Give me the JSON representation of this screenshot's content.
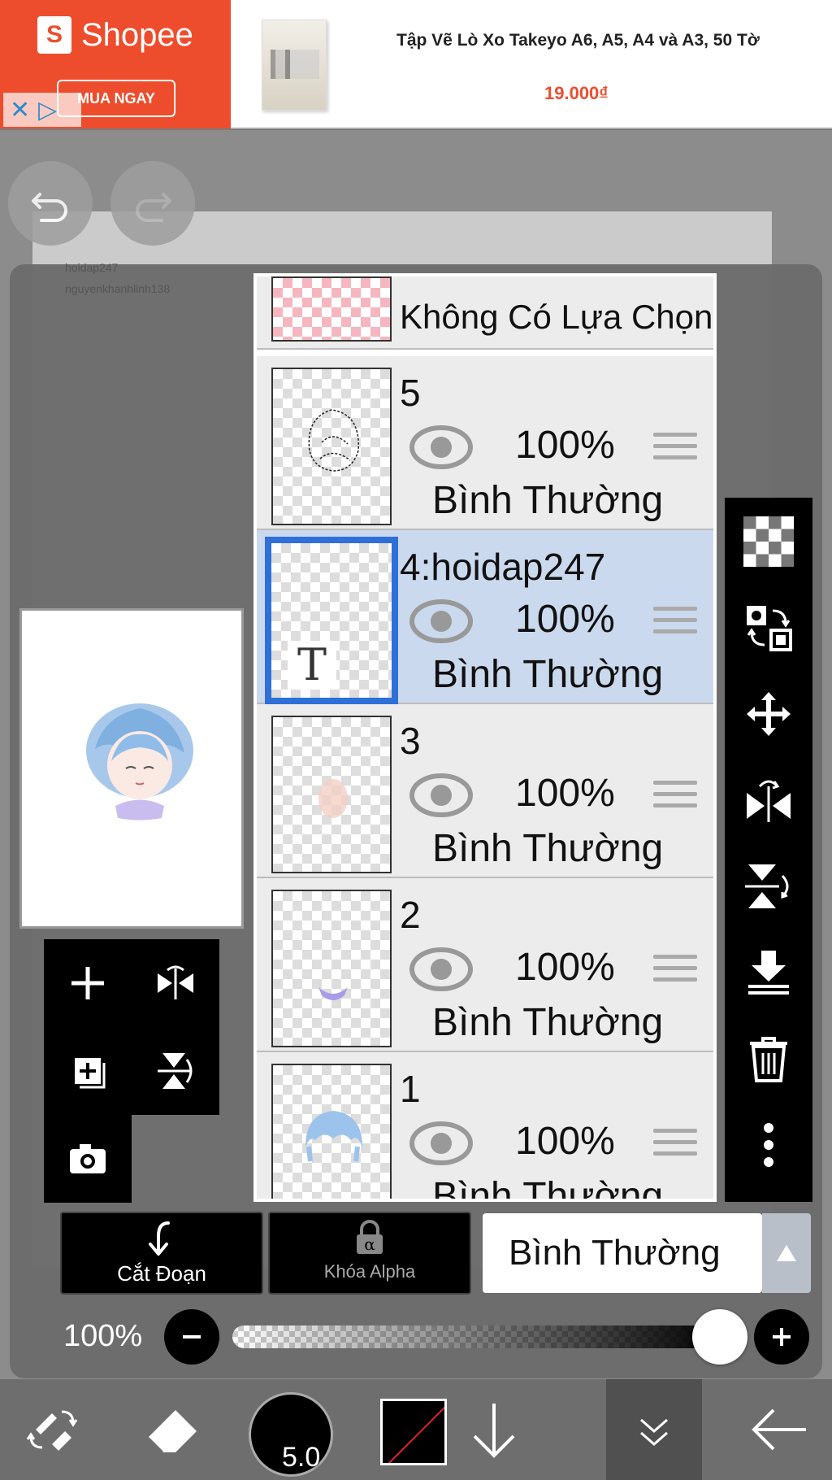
{
  "ad": {
    "brand": "Shopee",
    "cta": "MUA NGAY",
    "product_title": "Tập Vẽ Lò Xo Takeyo A6, A5, A4 và A3, 50 Tờ",
    "price": "19.000₫",
    "brand_color": "#ee4d2d"
  },
  "canvas": {
    "watermark_1": "hoidap247",
    "watermark_2": "nguyenkhanhlinh138"
  },
  "layers": {
    "selection_row": {
      "label": "Không Có Lựa Chọn"
    },
    "items": [
      {
        "name": "5",
        "opacity": "100%",
        "blend": "Bình Thường",
        "selected": false
      },
      {
        "name": "4:hoidap247",
        "opacity": "100%",
        "blend": "Bình Thường",
        "selected": true,
        "type": "T"
      },
      {
        "name": "3",
        "opacity": "100%",
        "blend": "Bình Thường",
        "selected": false
      },
      {
        "name": "2",
        "opacity": "100%",
        "blend": "Bình Thường",
        "selected": false
      },
      {
        "name": "1",
        "opacity": "100%",
        "blend": "Bình Thường",
        "selected": false
      }
    ],
    "selected_color": "#cbd9ee",
    "selected_border": "#2f6fd8"
  },
  "buttons": {
    "clipping": "Cắt Đoạn",
    "alpha_lock": "Khóa Alpha",
    "blend_mode": "Bình Thường"
  },
  "opacity": {
    "value": "100%",
    "level": 1.0
  },
  "brush": {
    "size": "5.0",
    "color": "#000000"
  },
  "icons": {
    "undo": "undo-icon",
    "redo": "redo-icon",
    "right_toolbar": [
      "checker-icon",
      "transfer-icon",
      "move-icon",
      "flip-horizontal-icon",
      "flip-vertical-icon",
      "merge-down-icon",
      "trash-icon",
      "more-icon"
    ],
    "left_tools": [
      "add-layer-icon",
      "flip-layer-icon",
      "add-copy-icon",
      "rotate-layer-icon",
      "camera-icon"
    ],
    "bottom": [
      "transform-icon",
      "eraser-icon",
      "brush-icon",
      "color-icon",
      "move-down-icon",
      "collapse-icon",
      "back-icon"
    ]
  }
}
